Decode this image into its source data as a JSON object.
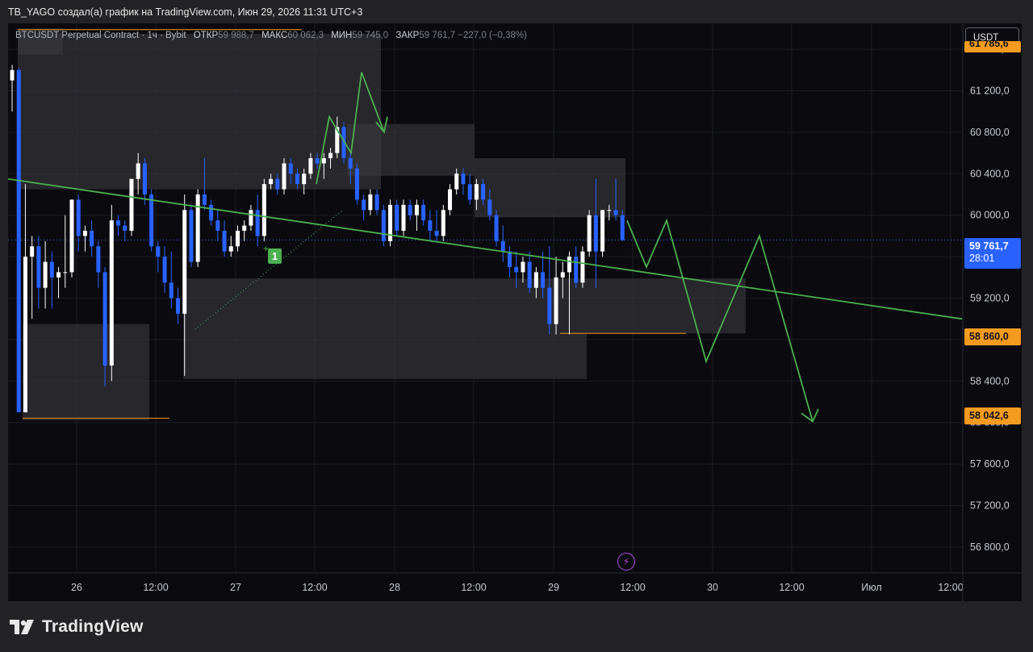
{
  "header": {
    "title": "TB_YAGO создал(а) график на TradingView.com, Июн 29, 2026 11:31 UTC+3"
  },
  "legend": {
    "symbol": "BTCUSDT Perpetual Contract · 1ч · Bybit",
    "open_label": "ОТКР",
    "open": "59 988,7",
    "high_label": "МАКС",
    "high": "60 062,3",
    "low_label": "МИН",
    "low": "59 745,0",
    "close_label": "ЗАКР",
    "close": "59 761,7",
    "change": "−227,0 (−0,38%)"
  },
  "currency_button": "USDT",
  "price_labels": {
    "top_partial": "61 785,6",
    "level_1": "58 860,0",
    "level_2": "58 042,6",
    "last_price": "59 761,7",
    "countdown": "28:01"
  },
  "marker_label": "1",
  "brand": {
    "name": "TradingView"
  },
  "colors": {
    "up": "#ffffff",
    "down": "#2962ff",
    "trend": "#4caf50",
    "level": "#f49b1f",
    "zone": "#3a3a40",
    "background": "#0b0b0f"
  },
  "chart_data": {
    "type": "candlestick",
    "y_ticks": [
      "61 600,0",
      "61 200,0",
      "60 800,0",
      "60 400,0",
      "60 000,0",
      "59 600,0",
      "59 200,0",
      "58 800,0",
      "58 400,0",
      "58 000,0",
      "57 600,0",
      "57 200,0",
      "56 800,0"
    ],
    "y_tick_values": [
      61600,
      61200,
      60800,
      60400,
      60000,
      59600,
      59200,
      58800,
      58400,
      58000,
      57600,
      57200,
      56800
    ],
    "ylim": [
      56550,
      61850
    ],
    "x_ticks": [
      "26",
      "12:00",
      "27",
      "12:00",
      "28",
      "12:00",
      "29",
      "12:00",
      "30",
      "12:00",
      "Июл",
      "12:00"
    ],
    "candles": [
      [
        61300,
        61450,
        61000,
        61400
      ],
      [
        61400,
        61420,
        58100,
        58100
      ],
      [
        58100,
        60300,
        58100,
        59600
      ],
      [
        59600,
        59800,
        59000,
        59700
      ],
      [
        59700,
        59800,
        59100,
        59300
      ],
      [
        59300,
        59750,
        59100,
        59550
      ],
      [
        59550,
        59650,
        59100,
        59400
      ],
      [
        59400,
        59500,
        59200,
        59450
      ],
      [
        59450,
        60000,
        59300,
        59450
      ],
      [
        59450,
        60150,
        59400,
        60150
      ],
      [
        60150,
        60200,
        59650,
        59800
      ],
      [
        59800,
        59900,
        59650,
        59850
      ],
      [
        59850,
        59950,
        59600,
        59700
      ],
      [
        59700,
        59750,
        59300,
        59450
      ],
      [
        59450,
        59500,
        58350,
        58550
      ],
      [
        58550,
        60100,
        58400,
        59950
      ],
      [
        59950,
        60000,
        59800,
        59900
      ],
      [
        59900,
        59950,
        59750,
        59850
      ],
      [
        59850,
        60350,
        59800,
        60350
      ],
      [
        60350,
        60600,
        60200,
        60500
      ],
      [
        60500,
        60550,
        60100,
        60200
      ],
      [
        60200,
        60250,
        59650,
        59700
      ],
      [
        59700,
        59750,
        59450,
        59600
      ],
      [
        59600,
        59700,
        59250,
        59350
      ],
      [
        59350,
        59650,
        59100,
        59200
      ],
      [
        59200,
        59300,
        58950,
        59050
      ],
      [
        59050,
        60200,
        58450,
        60050
      ],
      [
        60050,
        60100,
        59500,
        59550
      ],
      [
        59550,
        60250,
        59500,
        60200
      ],
      [
        60200,
        60550,
        60050,
        60100
      ],
      [
        60100,
        60150,
        59900,
        59950
      ],
      [
        59950,
        60050,
        59750,
        59850
      ],
      [
        59850,
        59950,
        59600,
        59650
      ],
      [
        59650,
        59800,
        59600,
        59700
      ],
      [
        59700,
        59900,
        59650,
        59850
      ],
      [
        59850,
        59950,
        59750,
        59900
      ],
      [
        59900,
        60100,
        59850,
        60050
      ],
      [
        60050,
        60200,
        59700,
        59800
      ],
      [
        59800,
        60350,
        59750,
        60300
      ],
      [
        60300,
        60400,
        60250,
        60350
      ],
      [
        60350,
        60400,
        60200,
        60250
      ],
      [
        60250,
        60550,
        60200,
        60500
      ],
      [
        60500,
        60550,
        60300,
        60400
      ],
      [
        60400,
        60450,
        60250,
        60300
      ],
      [
        60300,
        60450,
        60200,
        60400
      ],
      [
        60400,
        60600,
        60350,
        60550
      ],
      [
        60550,
        60600,
        60450,
        60500
      ],
      [
        60500,
        60600,
        60350,
        60550
      ],
      [
        60550,
        60650,
        60450,
        60600
      ],
      [
        60600,
        60950,
        60550,
        60850
      ],
      [
        60850,
        60900,
        60500,
        60550
      ],
      [
        60550,
        60600,
        60300,
        60450
      ],
      [
        60450,
        60500,
        60100,
        60150
      ],
      [
        60150,
        60200,
        59950,
        60050
      ],
      [
        60050,
        60250,
        60000,
        60200
      ],
      [
        60200,
        60250,
        60000,
        60050
      ],
      [
        60050,
        60100,
        59700,
        59750
      ],
      [
        59750,
        60150,
        59700,
        60100
      ],
      [
        60100,
        60150,
        59800,
        59850
      ],
      [
        59850,
        60150,
        59800,
        60100
      ],
      [
        60100,
        60150,
        59950,
        60000
      ],
      [
        60000,
        60150,
        59850,
        60100
      ],
      [
        60100,
        60150,
        59900,
        59950
      ],
      [
        59950,
        60050,
        59750,
        59850
      ],
      [
        59850,
        60050,
        59750,
        59800
      ],
      [
        59800,
        60100,
        59750,
        60050
      ],
      [
        60050,
        60300,
        60000,
        60250
      ],
      [
        60250,
        60450,
        60200,
        60400
      ],
      [
        60400,
        60450,
        60200,
        60300
      ],
      [
        60300,
        60400,
        60100,
        60150
      ],
      [
        60150,
        60350,
        60050,
        60300
      ],
      [
        60300,
        60350,
        60100,
        60150
      ],
      [
        60150,
        60250,
        59950,
        60000
      ],
      [
        60000,
        60050,
        59700,
        59750
      ],
      [
        59750,
        59900,
        59550,
        59650
      ],
      [
        59650,
        59700,
        59400,
        59500
      ],
      [
        59500,
        59650,
        59300,
        59450
      ],
      [
        59450,
        59600,
        59350,
        59550
      ],
      [
        59550,
        59650,
        59250,
        59300
      ],
      [
        59300,
        59500,
        59200,
        59450
      ],
      [
        59450,
        59650,
        59200,
        59300
      ],
      [
        59300,
        59700,
        58850,
        58950
      ],
      [
        58950,
        59600,
        58850,
        59400
      ],
      [
        59400,
        59550,
        59200,
        59450
      ],
      [
        59450,
        59650,
        58850,
        59600
      ],
      [
        59600,
        59700,
        59300,
        59350
      ],
      [
        59350,
        59700,
        59300,
        59650
      ],
      [
        59650,
        60050,
        59600,
        60000
      ],
      [
        60000,
        60350,
        59300,
        59650
      ],
      [
        59650,
        60050,
        59600,
        60050
      ],
      [
        60050,
        60100,
        59950,
        60050
      ],
      [
        60050,
        60350,
        59950,
        60000
      ],
      [
        60000,
        60050,
        59750,
        59760
      ]
    ],
    "trend_line": {
      "from": [
        0,
        60350
      ],
      "to": [
        1182,
        59000
      ]
    },
    "levels": [
      "58 860,0",
      "58 042,6"
    ]
  }
}
